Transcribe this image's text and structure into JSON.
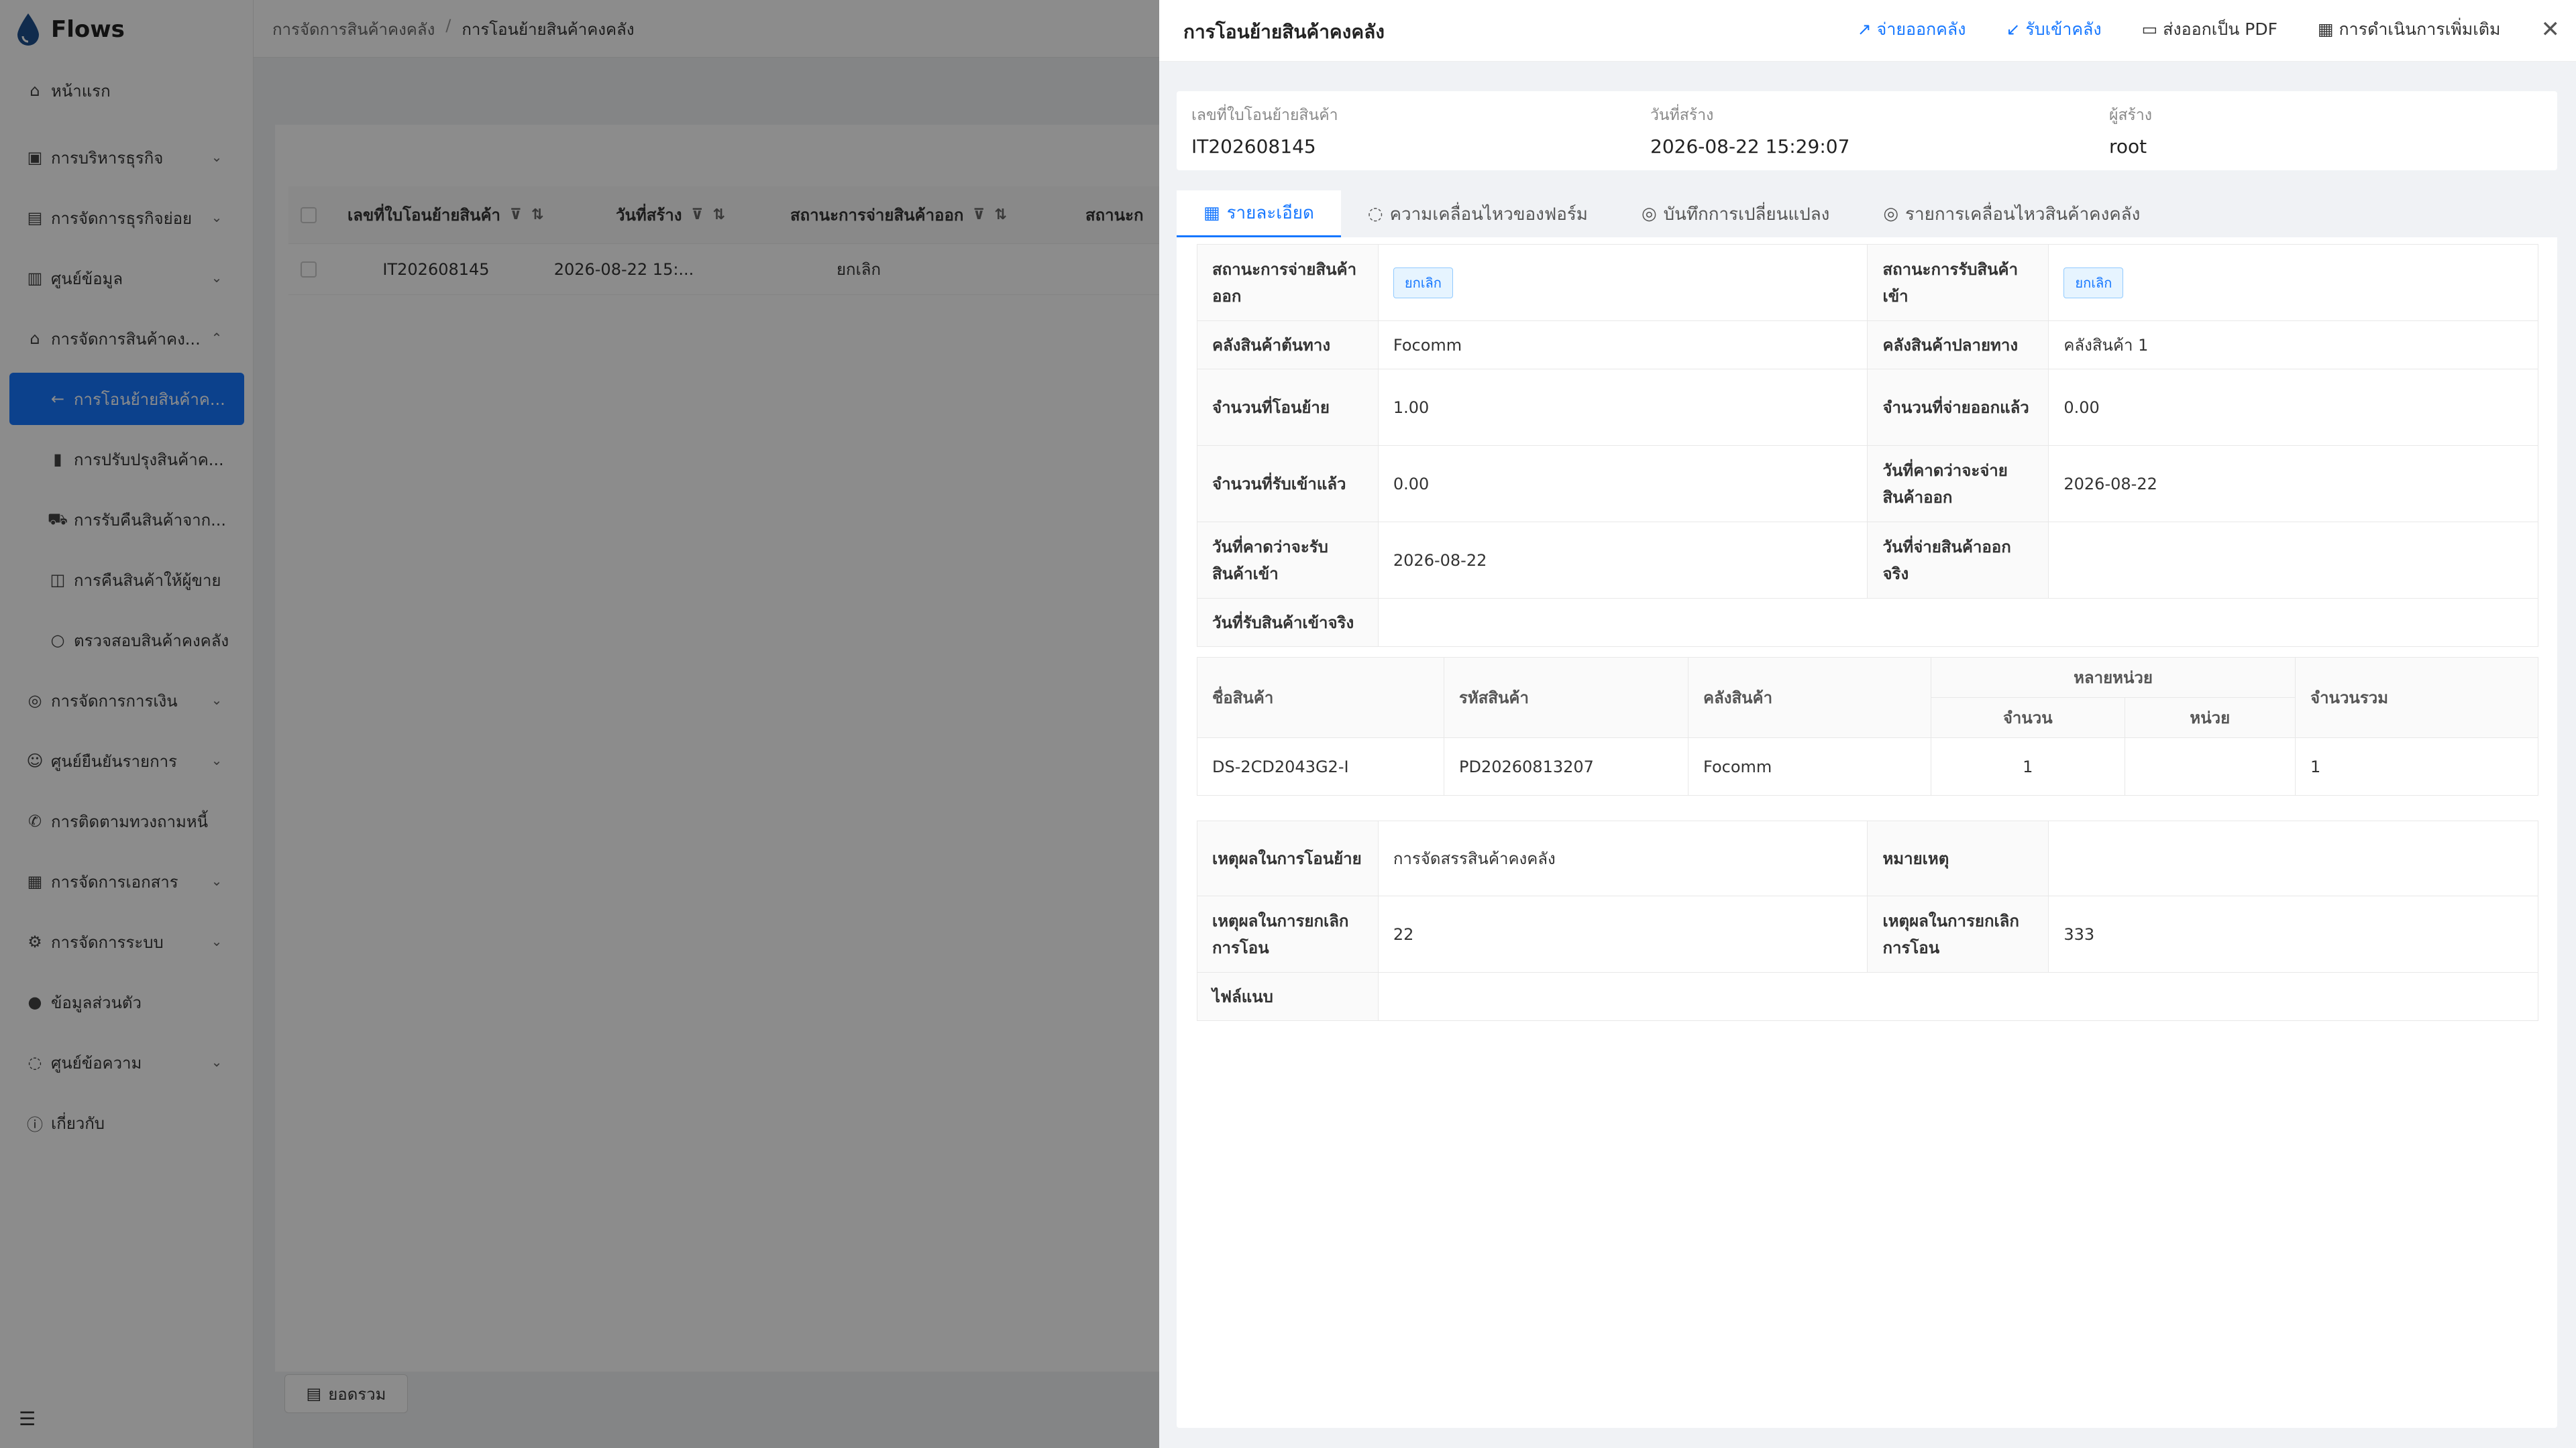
{
  "app": {
    "name": "Flows"
  },
  "sidebar": {
    "items": [
      {
        "label": "หน้าแรก",
        "icon": "home-icon",
        "chevron": false
      },
      {
        "label": "การบริหารธุรกิจ",
        "icon": "briefcase-icon",
        "chevron": true
      },
      {
        "label": "การจัดการธุรกิจย่อย",
        "icon": "document-icon",
        "chevron": true
      },
      {
        "label": "ศูนย์ข้อมูล",
        "icon": "chart-icon",
        "chevron": true
      },
      {
        "label": "การจัดการสินค้าคง...",
        "icon": "home-icon",
        "chevron": true,
        "expanded": true
      }
    ],
    "sub_items": [
      {
        "label": "การโอนย้ายสินค้าค...",
        "icon": "arrow-left-icon",
        "active": true
      },
      {
        "label": "การปรับปรุงสินค้าค...",
        "icon": "bar-chart-icon"
      },
      {
        "label": "การรับคืนสินค้าจาก...",
        "icon": "cart-icon"
      },
      {
        "label": "การคืนสินค้าให้ผู้ขาย",
        "icon": "bag-icon"
      },
      {
        "label": "ตรวจสอบสินค้าคงคลัง",
        "icon": "search-icon"
      }
    ],
    "items_bottom": [
      {
        "label": "การจัดการการเงิน",
        "icon": "money-icon",
        "chevron": true
      },
      {
        "label": "ศูนย์ยืนยันรายการ",
        "icon": "user-icon",
        "chevron": true
      },
      {
        "label": "การติดตามทวงถามหนี้",
        "icon": "phone-icon",
        "chevron": false
      },
      {
        "label": "การจัดการเอกสาร",
        "icon": "file-icon",
        "chevron": true
      },
      {
        "label": "การจัดการระบบ",
        "icon": "gear-icon",
        "chevron": true
      },
      {
        "label": "ข้อมูลส่วนตัว",
        "icon": "person-icon",
        "chevron": false
      },
      {
        "label": "ศูนย์ข้อความ",
        "icon": "message-icon",
        "chevron": true
      },
      {
        "label": "เกี่ยวกับ",
        "icon": "info-icon",
        "chevron": false
      }
    ]
  },
  "breadcrumb": {
    "parent": "การจัดการสินค้าคงคลัง",
    "separator": "/",
    "current": "การโอนย้ายสินค้าคงคลัง"
  },
  "list": {
    "columns": [
      "เลขที่ใบโอนย้ายสินค้า",
      "วันที่สร้าง",
      "สถานะการจ่ายสินค้าออก",
      "สถานะก"
    ],
    "rows": [
      [
        "IT202608145",
        "2026-08-22 15:...",
        "ยกเลิก"
      ]
    ],
    "summary_button": "ยอดรวม"
  },
  "drawer": {
    "title": "การโอนย้ายสินค้าคงคลัง",
    "actions": {
      "issue": "จ่ายออกคลัง",
      "receive": "รับเข้าคลัง",
      "export_pdf": "ส่งออกเป็น PDF",
      "more": "การดำเนินการเพิ่มเติม"
    },
    "header_info": {
      "transfer_no_label": "เลขที่ใบโอนย้ายสินค้า",
      "transfer_no": "IT202608145",
      "created_label": "วันที่สร้าง",
      "created": "2026-08-22 15:29:07",
      "creator_label": "ผู้สร้าง",
      "creator": "root"
    },
    "tabs": [
      "รายละเอียด",
      "ความเคลื่อนไหวของฟอร์ม",
      "บันทึกการเปลี่ยนแปลง",
      "รายการเคลื่อนไหวสินค้าคงคลัง"
    ],
    "details": {
      "out_status_label": "สถานะการจ่ายสินค้าออก",
      "out_status": "ยกเลิก",
      "in_status_label": "สถานะการรับสินค้าเข้า",
      "in_status": "ยกเลิก",
      "src_wh_label": "คลังสินค้าต้นทาง",
      "src_wh": "Focomm",
      "dst_wh_label": "คลังสินค้าปลายทาง",
      "dst_wh": "คลังสินค้า 1",
      "qty_transfer_label": "จำนวนที่โอนย้าย",
      "qty_transfer": "1.00",
      "qty_issued_label": "จำนวนที่จ่ายออกแล้ว",
      "qty_issued": "0.00",
      "qty_received_label": "จำนวนที่รับเข้าแล้ว",
      "qty_received": "0.00",
      "exp_issue_date_label": "วันที่คาดว่าจะจ่ายสินค้าออก",
      "exp_issue_date": "2026-08-22",
      "exp_receive_date_label": "วันที่คาดว่าจะรับสินค้าเข้า",
      "exp_receive_date": "2026-08-22",
      "actual_issue_date_label": "วันที่จ่ายสินค้าออกจริง",
      "actual_issue_date": "",
      "actual_receive_date_label": "วันที่รับสินค้าเข้าจริง",
      "actual_receive_date": ""
    },
    "products": {
      "headers": {
        "name": "ชื่อสินค้า",
        "code": "รหัสสินค้า",
        "warehouse": "คลังสินค้า",
        "multi_unit": "หลายหน่วย",
        "qty": "จำนวน",
        "unit": "หน่วย",
        "total": "จำนวนรวม"
      },
      "rows": [
        {
          "name": "DS-2CD2043G2-I",
          "code": "PD20260813207",
          "warehouse": "Focomm",
          "qty": "1",
          "unit": "",
          "total": "1"
        }
      ]
    },
    "extra": {
      "reason_label": "เหตุผลในการโอนย้าย",
      "reason": "การจัดสรรสินค้าคงคลัง",
      "note_label": "หมายเหตุ",
      "note": "",
      "cancel_reason_label": "เหตุผลในการยกเลิกการโอน",
      "cancel_reason": "22",
      "cancel_reason2_label": "เหตุผลในการยกเลิกการโอน",
      "cancel_reason2": "333",
      "attachment_label": "ไฟล์แนบ",
      "attachment": ""
    }
  },
  "colors": {
    "accent": "#1677ff",
    "mask": "rgba(0,0,0,0.45)"
  }
}
